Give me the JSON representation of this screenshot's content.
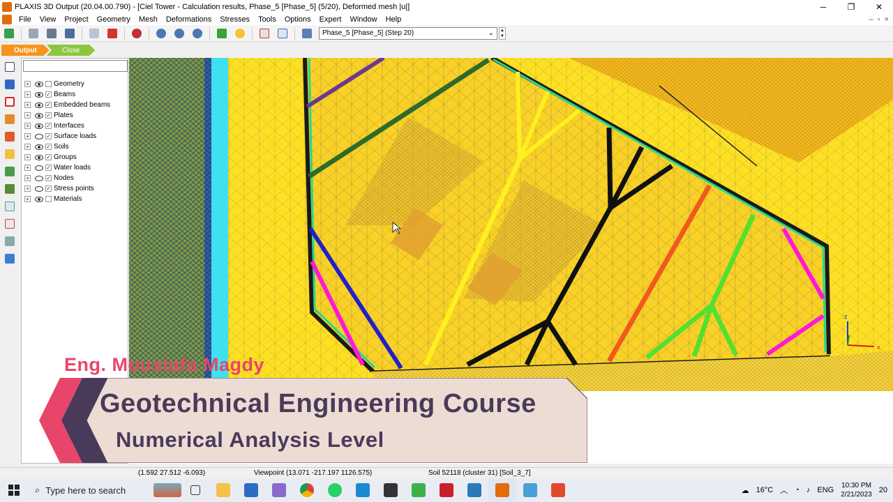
{
  "window": {
    "title": "PLAXIS 3D Output (20.04.00.790) - [Ciel Tower - Calculation results, Phase_5 [Phase_5] (5/20), Deformed mesh |u|]",
    "controls": [
      "─",
      "❐",
      "✕"
    ]
  },
  "menu": {
    "items": [
      "File",
      "View",
      "Project",
      "Geometry",
      "Mesh",
      "Deformations",
      "Stresses",
      "Tools",
      "Options",
      "Expert",
      "Window",
      "Help"
    ],
    "mdi_controls": [
      "–",
      "▫",
      "×"
    ]
  },
  "toolbar": {
    "phase_select": "Phase_5 [Phase_5] (Step 20)"
  },
  "tabs": {
    "output": "Output",
    "close": "Close"
  },
  "explorer": {
    "search_placeholder": "",
    "items": [
      {
        "label": "Geometry",
        "eye": true,
        "checked": false
      },
      {
        "label": "Beams",
        "eye": true,
        "checked": true
      },
      {
        "label": "Embedded beams",
        "eye": true,
        "checked": true
      },
      {
        "label": "Plates",
        "eye": true,
        "checked": true
      },
      {
        "label": "Interfaces",
        "eye": true,
        "checked": true
      },
      {
        "label": "Surface loads",
        "eye": false,
        "checked": true
      },
      {
        "label": "Soils",
        "eye": true,
        "checked": true
      },
      {
        "label": "Groups",
        "eye": true,
        "checked": true
      },
      {
        "label": "Water loads",
        "eye": false,
        "checked": true
      },
      {
        "label": "Nodes",
        "eye": false,
        "checked": true
      },
      {
        "label": "Stress points",
        "eye": false,
        "checked": true
      },
      {
        "label": "Materials",
        "eye": true,
        "checked": false
      }
    ]
  },
  "status": {
    "coords": "(1.592 27.512 -6.093)",
    "viewpoint": "Viewpoint (13.071 -217.197 1126.575)",
    "soil": "Soil 52118 (cluster 31) [Soil_3_7]"
  },
  "overlay": {
    "author": "Eng. Moustafa Magdy",
    "line1": "Geotechnical Engineering Course",
    "line2": "Numerical Analysis Level"
  },
  "axes": {
    "z": "z",
    "x": "x"
  },
  "taskbar": {
    "search_text": "Type here to search",
    "temperature": "16°C",
    "language": "ENG",
    "time": "10:30 PM",
    "date": "2/21/2023",
    "notifications": "20"
  },
  "colors": {
    "soil_yellow": "#fde023",
    "soil_orange": "#f6b21a",
    "cyan": "#3fe0f0",
    "green_dark": "#2e6b2a",
    "accent_output": "#f7941d",
    "accent_close": "#8cc63f"
  }
}
